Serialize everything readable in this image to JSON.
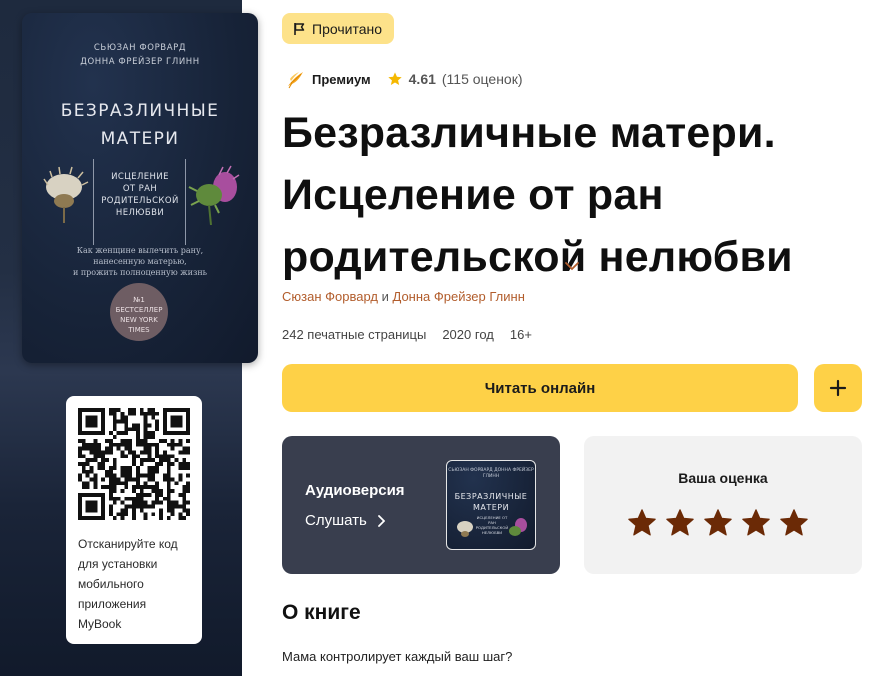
{
  "cover": {
    "authors_line1": "СЬЮЗАН ФОРВАРД",
    "authors_line2": "ДОННА ФРЕЙЗЕР ГЛИНН",
    "title_line1": "БЕЗРАЗЛИЧНЫЕ",
    "title_line2": "МАТЕРИ",
    "subtitle_line1": "ИСЦЕЛЕНИЕ",
    "subtitle_line2": "ОТ РАН",
    "subtitle_line3": "РОДИТЕЛЬСКОЙ",
    "subtitle_line4": "НЕЛЮБВИ",
    "tagline_line1": "Как женщине вылечить рану,",
    "tagline_line2": "нанесенную матерью,",
    "tagline_line3": "и прожить полноценную жизнь",
    "badge_line1": "№1",
    "badge_line2": "БЕСТСЕЛЛЕР",
    "badge_line3": "NEW YORK",
    "badge_line4": "TIMES"
  },
  "qr": {
    "caption_line1": "Отсканируйте код",
    "caption_line2": "для установки",
    "caption_line3": "мобильного",
    "caption_line4": "приложения",
    "caption_line5": "MyBook"
  },
  "status": {
    "read_label": "Прочитано"
  },
  "meta": {
    "premium_label": "Премиум",
    "rating_value": "4.61",
    "rating_count": "(115 оценок)"
  },
  "book": {
    "title_line1": "Безразличные матери.",
    "title_line2": "Исцеление от ран",
    "title_line3": "родительской нелюбви",
    "author1": "Сюзан Форвард",
    "author_sep": "и",
    "author2": "Донна Фрейзер Глинн",
    "pages": "242 печатные страницы",
    "year": "2020 год",
    "age": "16+"
  },
  "actions": {
    "read_online": "Читать онлайн",
    "add": "+"
  },
  "audio": {
    "title": "Аудиоверсия",
    "listen": "Слушать",
    "mini_authors": "СЬЮЗАН ФОРВАРД  ДОННА ФРЕЙЗЕР ГЛИНН",
    "mini_title_line1": "БЕЗРАЗЛИЧНЫЕ",
    "mini_title_line2": "МАТЕРИ",
    "mini_subtitle": "ИСЦЕЛЕНИЕ ОТ РАН РОДИТЕЛЬСКОЙ НЕЛЮБВИ"
  },
  "your_rating": {
    "title": "Ваша оценка",
    "stars_total": 5,
    "star_color": "#6b2a06"
  },
  "about": {
    "heading": "О книге",
    "first_line": "Мама контролирует каждый ваш шаг?"
  },
  "colors": {
    "accent_yellow": "#fed147",
    "read_badge": "#fde28a",
    "author_link": "#b25d2c",
    "audio_card": "#393e4e",
    "rating_star": "#f5b800"
  }
}
